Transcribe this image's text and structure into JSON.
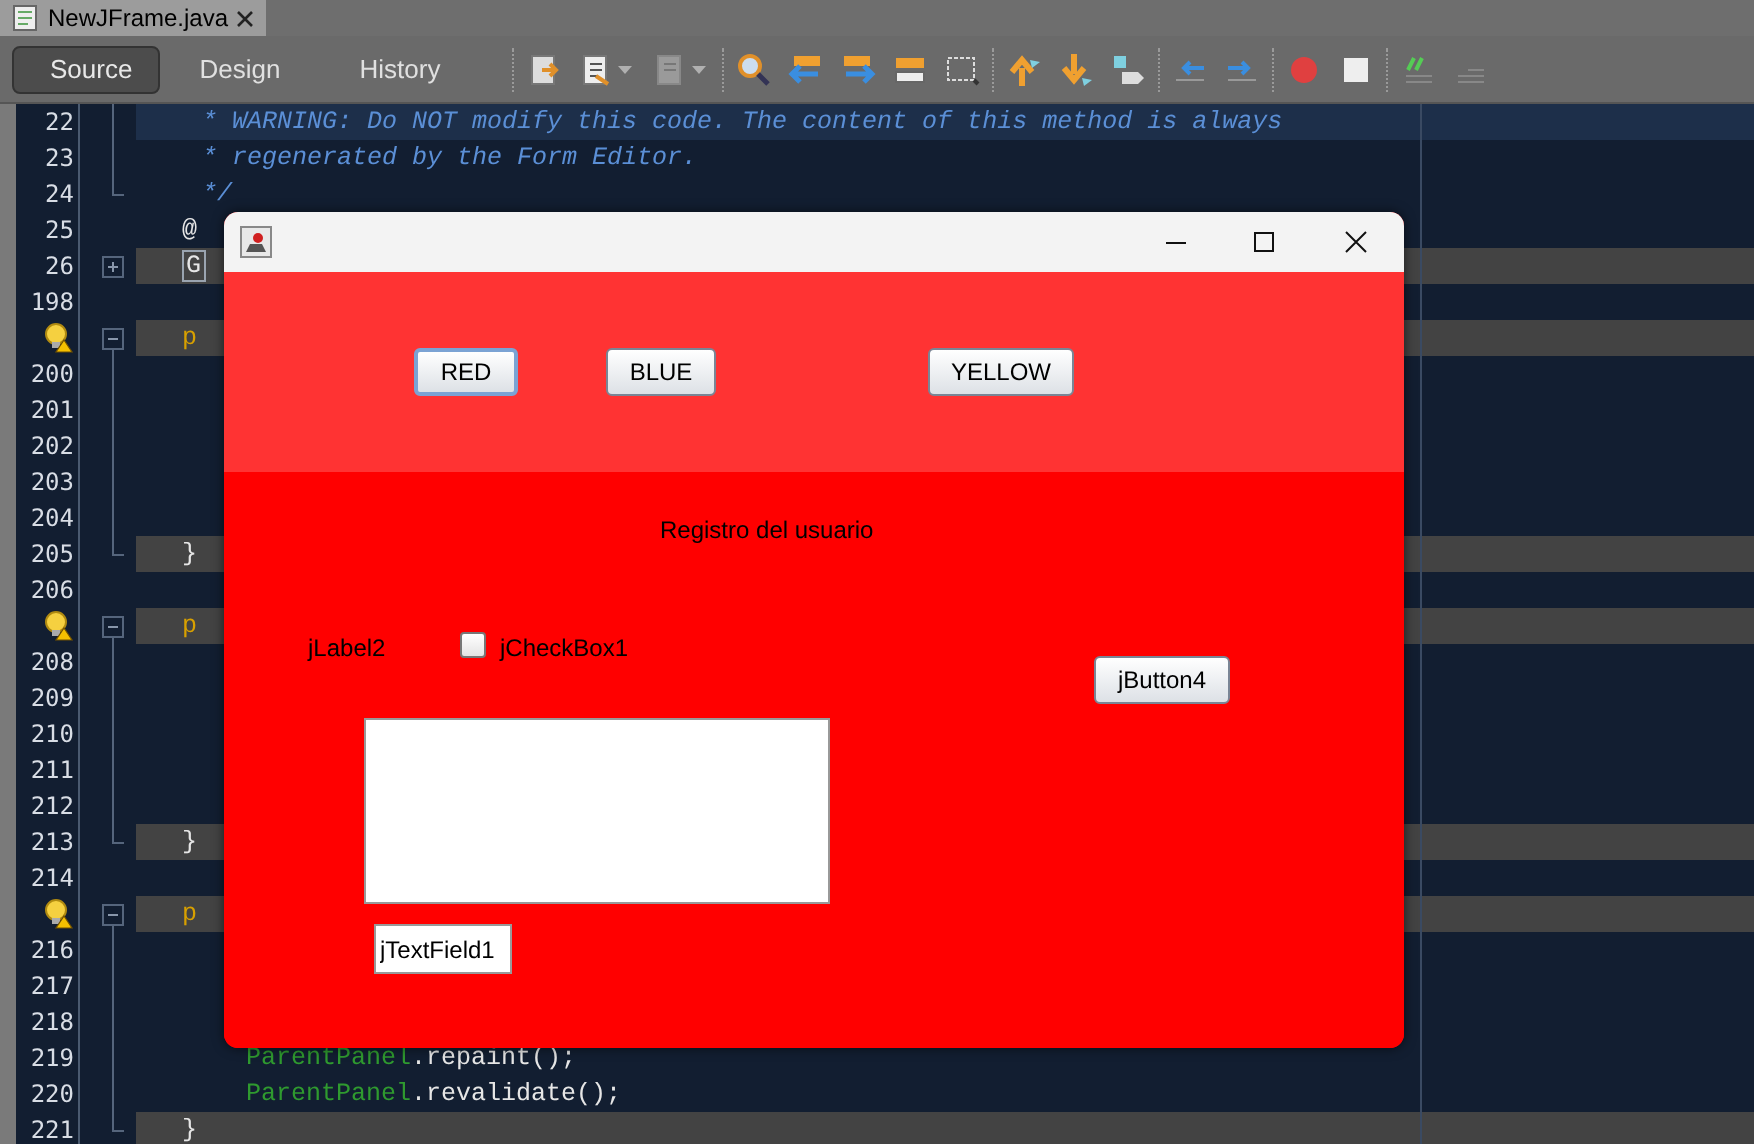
{
  "editor_tabs": [
    {
      "label": "NewJFrame.java",
      "selected": true
    }
  ],
  "view_tabs": [
    {
      "label": "Source",
      "selected": true
    },
    {
      "label": "Design",
      "selected": false
    },
    {
      "label": "History",
      "selected": false
    }
  ],
  "lines": [
    {
      "number": "22",
      "current": true,
      "in_fold": true,
      "segments": [
        {
          "text": "* WARNING: Do NOT modify this code. The content of this method is always",
          "kind": "comment"
        }
      ]
    },
    {
      "number": "23",
      "in_fold": true,
      "segments": [
        {
          "text": "* regenerated by the Form Editor.",
          "kind": "comment"
        }
      ]
    },
    {
      "number": "24",
      "fold_end": true,
      "segments": [
        {
          "text": "*/",
          "kind": "comment"
        }
      ]
    },
    {
      "number": "25",
      "segments": [
        {
          "text": "@",
          "kind": "plain"
        }
      ]
    },
    {
      "number": "26",
      "guarded": true,
      "collapsed": true,
      "segments": [
        {
          "text": "G",
          "kind": "folded"
        }
      ]
    },
    {
      "number": "198"
    },
    {
      "warning": true,
      "guarded": true,
      "expanded": true,
      "segments": [
        {
          "text": "p",
          "kind": "keyword"
        }
      ]
    },
    {
      "number": "200",
      "in_fold": true
    },
    {
      "number": "201",
      "in_fold": true
    },
    {
      "number": "202",
      "in_fold": true
    },
    {
      "number": "203",
      "in_fold": true
    },
    {
      "number": "204",
      "in_fold": true
    },
    {
      "number": "205",
      "guarded": true,
      "fold_end": true,
      "segments": [
        {
          "text": "}",
          "kind": "plain"
        }
      ]
    },
    {
      "number": "206"
    },
    {
      "warning": true,
      "guarded": true,
      "expanded": true,
      "segments": [
        {
          "text": "p",
          "kind": "keyword"
        }
      ]
    },
    {
      "number": "208",
      "in_fold": true
    },
    {
      "number": "209",
      "in_fold": true
    },
    {
      "number": "210",
      "in_fold": true
    },
    {
      "number": "211",
      "in_fold": true
    },
    {
      "number": "212",
      "in_fold": true
    },
    {
      "number": "213",
      "guarded": true,
      "fold_end": true,
      "segments": [
        {
          "text": "}",
          "kind": "plain"
        }
      ]
    },
    {
      "number": "214"
    },
    {
      "warning": true,
      "guarded": true,
      "expanded": true,
      "segments": [
        {
          "text": "p",
          "kind": "keyword"
        }
      ]
    },
    {
      "number": "216",
      "in_fold": true
    },
    {
      "number": "217",
      "in_fold": true
    },
    {
      "number": "218",
      "in_fold": true
    },
    {
      "number": "219",
      "in_fold": true,
      "segments": [
        {
          "text": "ParentPanel",
          "kind": "field"
        },
        {
          "text": ".repaint();",
          "kind": "plain"
        }
      ]
    },
    {
      "number": "220",
      "in_fold": true,
      "segments": [
        {
          "text": "ParentPanel",
          "kind": "field"
        },
        {
          "text": ".revalidate();",
          "kind": "plain"
        }
      ]
    },
    {
      "number": "221",
      "guarded": true,
      "fold_end": true,
      "segments": [
        {
          "text": "}",
          "kind": "plain"
        }
      ]
    }
  ],
  "frame": {
    "top_buttons": [
      {
        "label": "RED",
        "focused": true
      },
      {
        "label": "BLUE",
        "focused": false
      },
      {
        "label": "YELLOW",
        "focused": false
      }
    ],
    "heading": "Registro del usuario",
    "label": "jLabel2",
    "checkbox": {
      "label": "jCheckBox1",
      "checked": false
    },
    "button": "jButton4",
    "text_field": {
      "value": "jTextField1"
    }
  }
}
